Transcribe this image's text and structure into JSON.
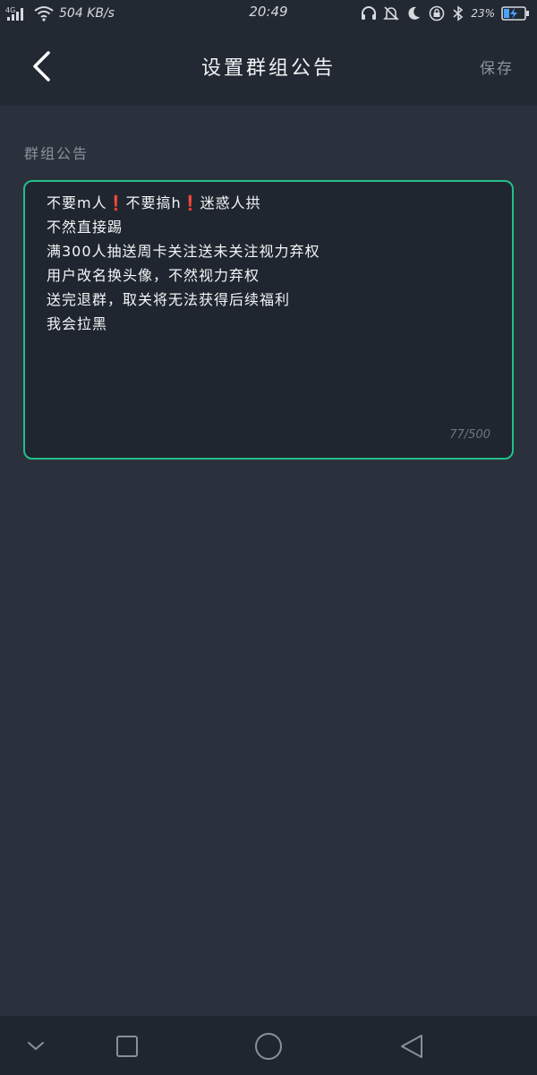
{
  "status_bar": {
    "network": "4G",
    "speed": "504 KB/s",
    "time": "20:49",
    "battery_percent": "23%"
  },
  "header": {
    "title": "设置群组公告",
    "save_label": "保存"
  },
  "form": {
    "section_label": "群组公告",
    "notice_text": "不要m人❗不要搞h❗迷惑人拱\n不然直接踢\n满300人抽送周卡关注送未关注视力弃权\n用户改名换头像，不然视力弃权\n送完退群，取关将无法获得后续福利\n我会拉黑",
    "char_count": "77/500"
  },
  "colors": {
    "background": "#2a313c",
    "header": "#222932",
    "accent_border": "#20c08a",
    "textarea_bg": "#1f262f"
  }
}
